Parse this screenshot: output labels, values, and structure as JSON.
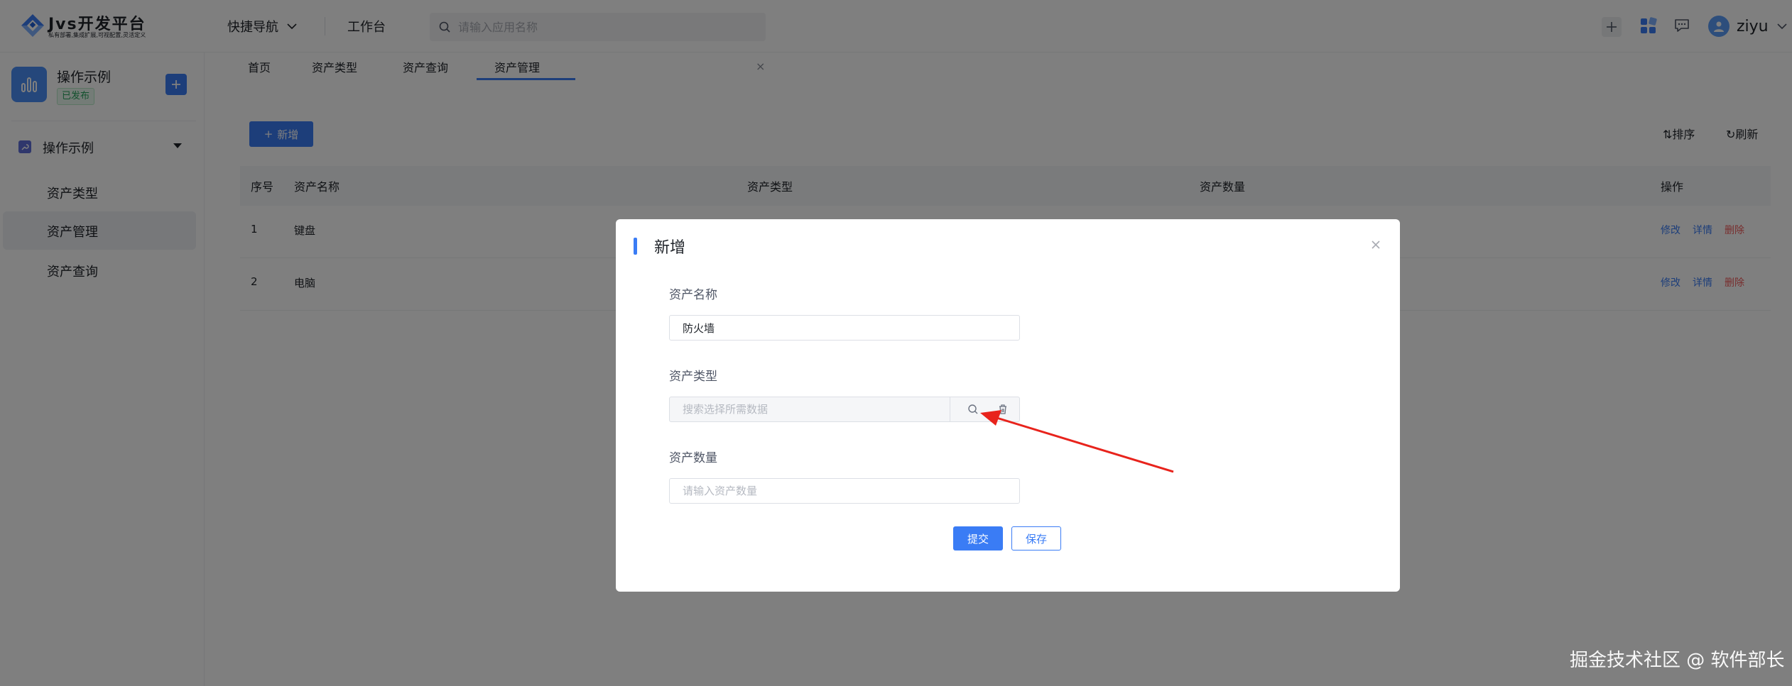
{
  "header": {
    "logo_title": "Jvs开发平台",
    "logo_slogan": "私有部署,集成扩展,可视配置,灵活定义",
    "quick_nav": "快捷导航",
    "workbench": "工作台",
    "search_placeholder": "请输入应用名称",
    "username": "ziyu"
  },
  "sidebar": {
    "app_name": "操作示例",
    "app_status": "已发布",
    "group_label": "操作示例",
    "items": [
      {
        "label": "资产类型",
        "active": false
      },
      {
        "label": "资产管理",
        "active": true
      },
      {
        "label": "资产查询",
        "active": false
      }
    ]
  },
  "tabs": [
    {
      "label": "首页"
    },
    {
      "label": "资产类型"
    },
    {
      "label": "资产查询"
    },
    {
      "label": "资产管理",
      "active": true,
      "closable": true
    }
  ],
  "main": {
    "new_button": "新增",
    "sort_label": "排序",
    "refresh_label": "刷新",
    "columns": [
      "序号",
      "资产名称",
      "资产类型",
      "资产数量",
      "操作"
    ],
    "rows": [
      {
        "index": "1",
        "name": "键盘",
        "type": "",
        "quantity": ""
      },
      {
        "index": "2",
        "name": "电脑",
        "type": "",
        "quantity": ""
      }
    ],
    "actions": {
      "edit": "修改",
      "detail": "详情",
      "delete": "删除"
    }
  },
  "dialog": {
    "title": "新增",
    "fields": {
      "name_label": "资产名称",
      "name_value": "防火墙",
      "type_label": "资产类型",
      "type_placeholder": "搜索选择所需数据",
      "qty_label": "资产数量",
      "qty_placeholder": "请输入资产数量"
    },
    "submit": "提交",
    "save": "保存"
  },
  "watermark": "掘金技术社区 @ 软件部长",
  "colors": {
    "primary": "#3a7cf5",
    "danger": "#f15b5b",
    "success": "#26a35c",
    "annotation_arrow": "#e8231c"
  }
}
